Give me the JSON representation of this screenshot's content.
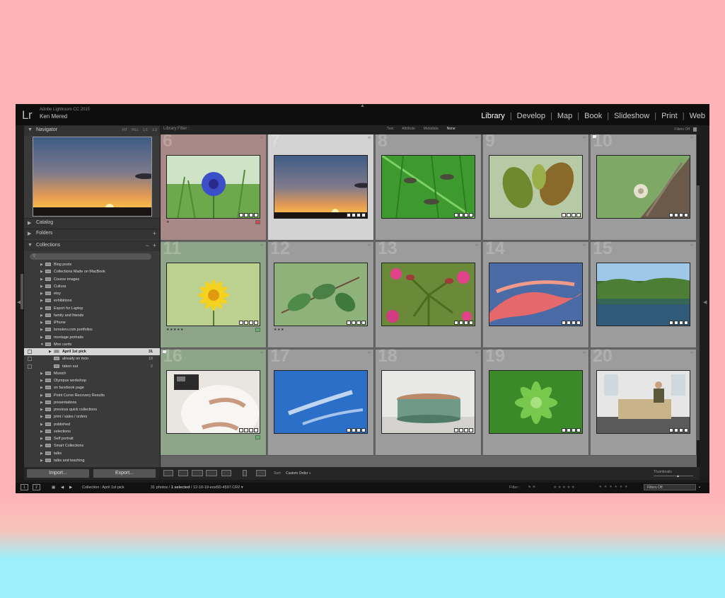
{
  "app": {
    "logo": "Lr",
    "name": "Adobe Lightroom CC 2015",
    "user": "Ken Mered",
    "modules": [
      "Library",
      "Develop",
      "Map",
      "Book",
      "Slideshow",
      "Print",
      "Web"
    ],
    "active_module": "Library"
  },
  "left_panel": {
    "navigator": {
      "title": "Navigator",
      "options": [
        "FIT",
        "FILL",
        "1:1",
        "1:2"
      ]
    },
    "catalog_title": "Catalog",
    "folders_title": "Folders",
    "collections_title": "Collections",
    "collections": [
      {
        "label": "Blog posts",
        "indent": 0,
        "arrow": "▶",
        "count": ""
      },
      {
        "label": "Collections Made on MacBook",
        "indent": 0,
        "arrow": "▶",
        "count": ""
      },
      {
        "label": "Course images",
        "indent": 0,
        "arrow": "▶",
        "count": ""
      },
      {
        "label": "Cultura",
        "indent": 0,
        "arrow": "▶",
        "count": ""
      },
      {
        "label": "etsy",
        "indent": 0,
        "arrow": "▶",
        "count": ""
      },
      {
        "label": "exhibitions",
        "indent": 0,
        "arrow": "▶",
        "count": ""
      },
      {
        "label": "Export for Laptop",
        "indent": 0,
        "arrow": "▶",
        "count": ""
      },
      {
        "label": "family and friends",
        "indent": 0,
        "arrow": "▶",
        "count": ""
      },
      {
        "label": "iPhone",
        "indent": 0,
        "arrow": "▶",
        "count": ""
      },
      {
        "label": "lomokev.com portfolios",
        "indent": 0,
        "arrow": "▶",
        "count": ""
      },
      {
        "label": "montage portraits",
        "indent": 0,
        "arrow": "▶",
        "count": ""
      },
      {
        "label": "Moo cards",
        "indent": 0,
        "arrow": "▼",
        "count": ""
      },
      {
        "label": "April 1st pick",
        "indent": 1,
        "arrow": "▶",
        "count": "31",
        "selected": true
      },
      {
        "label": "already on moo",
        "indent": 1,
        "arrow": "",
        "count": "18"
      },
      {
        "label": "taken out",
        "indent": 1,
        "arrow": "",
        "count": "2"
      },
      {
        "label": "Munich",
        "indent": 0,
        "arrow": "▶",
        "count": ""
      },
      {
        "label": "Olympus workshop",
        "indent": 0,
        "arrow": "▶",
        "count": ""
      },
      {
        "label": "on facebook page",
        "indent": 0,
        "arrow": "▶",
        "count": ""
      },
      {
        "label": "Point Curve Recovery Results",
        "indent": 0,
        "arrow": "▶",
        "count": ""
      },
      {
        "label": "presentations",
        "indent": 0,
        "arrow": "▶",
        "count": ""
      },
      {
        "label": "previous quick collections",
        "indent": 0,
        "arrow": "▶",
        "count": ""
      },
      {
        "label": "print / sales / orders",
        "indent": 0,
        "arrow": "▶",
        "count": ""
      },
      {
        "label": "published",
        "indent": 0,
        "arrow": "▶",
        "count": ""
      },
      {
        "label": "selections",
        "indent": 0,
        "arrow": "▶",
        "count": ""
      },
      {
        "label": "Self portrait",
        "indent": 0,
        "arrow": "▶",
        "count": ""
      },
      {
        "label": "Smart Collections",
        "indent": 0,
        "arrow": "▶",
        "count": ""
      },
      {
        "label": "talks",
        "indent": 0,
        "arrow": "▶",
        "count": ""
      },
      {
        "label": "talks and teaching",
        "indent": 0,
        "arrow": "▶",
        "count": ""
      }
    ],
    "import_label": "Import...",
    "export_label": "Export..."
  },
  "filter_bar": {
    "label": "Library Filter :",
    "options": [
      "Text",
      "Attribute",
      "Metadata",
      "None"
    ],
    "active": "None",
    "filters_off": "Filters Off"
  },
  "grid": {
    "cells": [
      {
        "num": "6",
        "style": "red",
        "subject": "cornflower",
        "stars": "★",
        "label_color": "#d24b4b"
      },
      {
        "num": "7",
        "style": "sel",
        "subject": "sunset",
        "stars": ""
      },
      {
        "num": "8",
        "style": "normal",
        "subject": "leaf",
        "stars": ""
      },
      {
        "num": "9",
        "style": "normal",
        "subject": "leaves",
        "stars": ""
      },
      {
        "num": "10",
        "style": "normal",
        "subject": "snail",
        "stars": ""
      },
      {
        "num": "11",
        "style": "green",
        "subject": "daisy",
        "stars": "★★★★★",
        "label_color": "#5fb95f"
      },
      {
        "num": "12",
        "style": "normal",
        "subject": "rose-leaves",
        "stars": "★★★"
      },
      {
        "num": "13",
        "style": "normal",
        "subject": "buds",
        "stars": ""
      },
      {
        "num": "14",
        "style": "normal",
        "subject": "pink-clouds",
        "stars": ""
      },
      {
        "num": "15",
        "style": "normal",
        "subject": "lake",
        "stars": ""
      },
      {
        "num": "16",
        "style": "green",
        "subject": "pregnant",
        "stars": "",
        "label_color": "#5fb95f"
      },
      {
        "num": "17",
        "style": "normal",
        "subject": "sky",
        "stars": ""
      },
      {
        "num": "18",
        "style": "normal",
        "subject": "bowl",
        "stars": ""
      },
      {
        "num": "19",
        "style": "normal",
        "subject": "succulent",
        "stars": ""
      },
      {
        "num": "20",
        "style": "normal",
        "subject": "sofa",
        "stars": ""
      }
    ]
  },
  "toolbar": {
    "sort_label": "Sort:",
    "sort_value": "Custom Order ÷",
    "thumbnails_label": "Thumbnails"
  },
  "filmstrip": {
    "screen1": "1",
    "screen2": "2",
    "source": "Collection : April 1st pick",
    "count_text": "31 photos / ",
    "selected_text": "1 selected",
    "file_text": " / 12-10-19-eos5D-4597.CR2 ▾",
    "filter_label": "Filter :",
    "filters_value": "Filters Off"
  },
  "colors": {
    "background_top": "#ffb3b6",
    "background_bottom": "#9cf0fb",
    "app_bg": "#1b1b1b",
    "panel_bg": "#3a3a3a",
    "grid_bg": "#9c9c9c",
    "selected_cell": "#d3d3d3",
    "red_label_cell": "#a98888",
    "green_label_cell": "#8ea58a"
  }
}
